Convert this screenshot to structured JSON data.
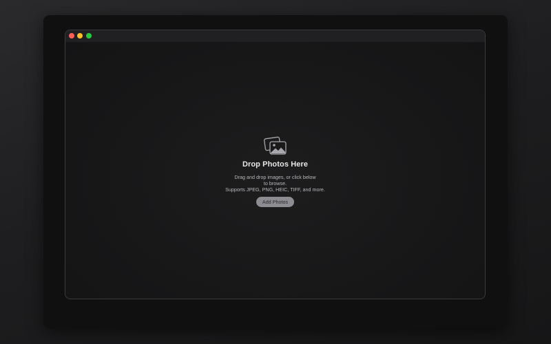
{
  "window": {
    "traffic_lights": [
      "close",
      "minimize",
      "zoom"
    ]
  },
  "drop_zone": {
    "icon": "photos-icon",
    "title": "Drop Photos Here",
    "description_lines": [
      "Drag and drop images, or click below",
      "to browse.",
      "Supports JPEG, PNG, HEIC, TIFF, and more."
    ],
    "button_label": "Add Photos"
  },
  "colors": {
    "close": "#ff5f57",
    "minimize": "#febc2e",
    "zoom": "#28c840",
    "button_bg": "#8e8e92",
    "title_text": "#e8e8ea"
  }
}
